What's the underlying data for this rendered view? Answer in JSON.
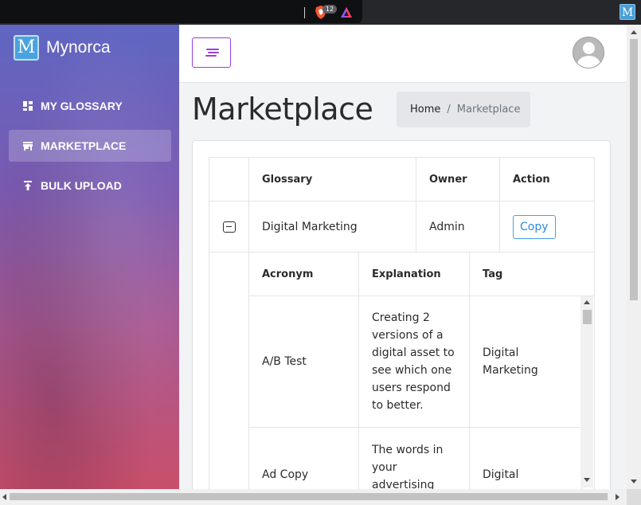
{
  "browser": {
    "brave_badge": "12",
    "extension_letter": "M"
  },
  "sidebar": {
    "brand_letter": "M",
    "brand_name": "Mynorca",
    "items": [
      {
        "label": "MY GLOSSARY",
        "icon": "dashboard-icon",
        "active": false
      },
      {
        "label": "MARKETPLACE",
        "icon": "store-icon",
        "active": true
      },
      {
        "label": "BULK UPLOAD",
        "icon": "upload-icon",
        "active": false
      }
    ]
  },
  "header": {
    "title": "Marketplace",
    "breadcrumb": {
      "home": "Home",
      "separator": "/",
      "current": "Marketplace"
    }
  },
  "outer_table": {
    "headers": [
      "Glossary",
      "Owner",
      "Action"
    ],
    "rows": [
      {
        "glossary": "Digital Marketing",
        "owner": "Admin",
        "action": "Copy"
      }
    ]
  },
  "inner_table": {
    "headers": [
      "Acronym",
      "Explanation",
      "Tag"
    ],
    "rows": [
      {
        "acronym": "A/B Test",
        "explanation": "Creating 2 versions of a digital asset to see which one users respond to better.",
        "tag": "Digital Marketing"
      },
      {
        "acronym": "Ad Copy",
        "explanation": "The words in your advertising",
        "tag": "Digital"
      }
    ]
  },
  "colors": {
    "accent_purple": "#9b3fd9",
    "copy_blue": "#2f8ad6",
    "sidebar_top": "#5f66c2",
    "sidebar_bottom": "#c94f6a"
  }
}
